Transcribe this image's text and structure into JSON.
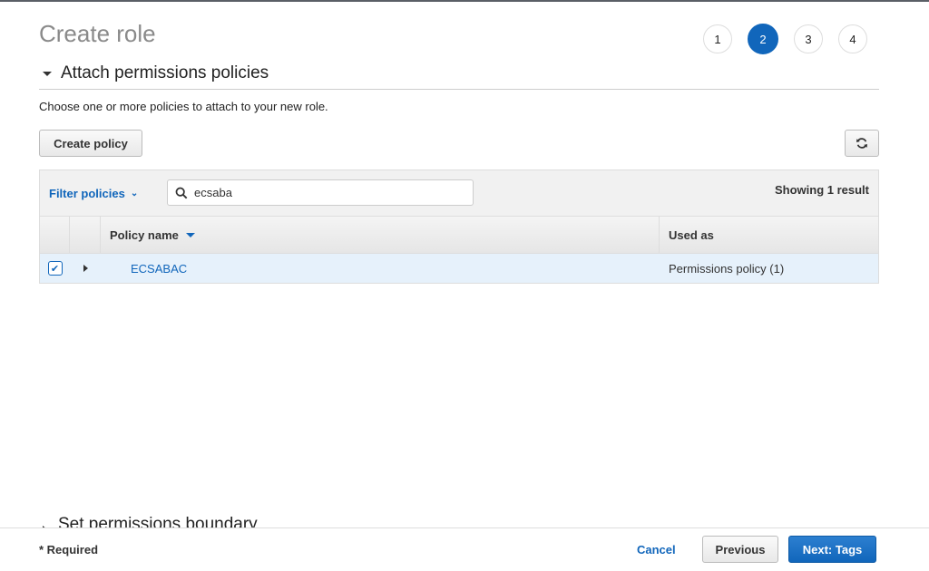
{
  "page": {
    "title": "Create role",
    "steps": [
      {
        "label": "1",
        "active": false
      },
      {
        "label": "2",
        "active": true
      },
      {
        "label": "3",
        "active": false
      },
      {
        "label": "4",
        "active": false
      }
    ]
  },
  "section": {
    "title": "Attach permissions policies",
    "description": "Choose one or more policies to attach to your new role.",
    "create_policy_label": "Create policy",
    "refresh_icon": "refresh-icon"
  },
  "table": {
    "filter_label": "Filter policies",
    "search_value": "ecsaba",
    "search_icon": "search-icon",
    "result_count": "Showing 1 result",
    "columns": [
      "Policy name",
      "Used as"
    ],
    "rows": [
      {
        "checked": true,
        "name": "ECSABAC",
        "used_as": "Permissions policy (1)"
      }
    ]
  },
  "next_section": {
    "title": "Set permissions boundary"
  },
  "footer": {
    "required_note": "* Required",
    "cancel_label": "Cancel",
    "previous_label": "Previous",
    "next_label": "Next: Tags"
  },
  "colors": {
    "accent": "#1166bb",
    "selected_row": "#e6f1fb"
  }
}
